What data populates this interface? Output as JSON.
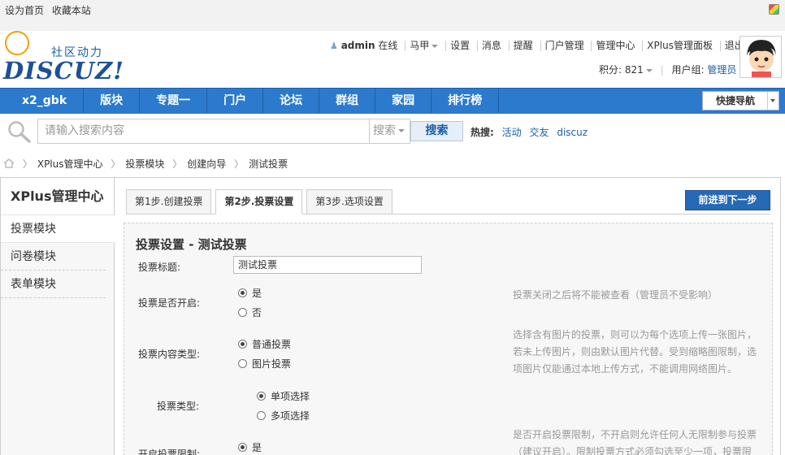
{
  "topbar": {
    "links": [
      "设为首页",
      "收藏本站"
    ]
  },
  "logo": {
    "tagline": "社区动力",
    "wordmark": "DISCUZ!"
  },
  "user_menu": {
    "username": "admin",
    "status": "在线",
    "items": [
      "马甲",
      "设置",
      "消息",
      "提醒",
      "门户管理",
      "管理中心",
      "XPlus管理面板",
      "退出"
    ],
    "credits_label": "积分: 821",
    "group_label": "用户组:",
    "group_value": "管理员"
  },
  "nav": {
    "tabs": [
      "x2_gbk",
      "版块",
      "专题一",
      "门户",
      "论坛",
      "群组",
      "家园",
      "排行榜"
    ],
    "quick_nav": "快捷导航"
  },
  "search": {
    "placeholder": "请输入搜索内容",
    "type": "搜索",
    "button": "搜索",
    "hot_label": "热搜:",
    "hot_keywords": [
      "活动",
      "交友",
      "discuz"
    ]
  },
  "breadcrumb": [
    "XPlus管理中心",
    "投票模块",
    "创建向导",
    "测试投票"
  ],
  "sidebar": {
    "title": "XPlus管理中心",
    "items": [
      "投票模块",
      "问卷模块",
      "表单模块"
    ]
  },
  "steps": [
    "第1步.创建投票",
    "第2步.投票设置",
    "第3步.选项设置"
  ],
  "next_button": "前进到下一步",
  "form": {
    "heading": "投票设置 - 测试投票",
    "title_label": "投票标题:",
    "title_value": "测试投票",
    "enabled_label": "投票是否开启:",
    "enabled_options": [
      "是",
      "否"
    ],
    "enabled_hint": "投票关闭之后将不能被查看（管理员不受影响）",
    "content_type_label": "投票内容类型:",
    "content_type_options": [
      "普通投票",
      "图片投票"
    ],
    "content_type_hint": "选择含有图片的投票，则可以为每个选项上传一张图片，若未上传图片，则由默认图片代替。受到缩略图限制，选项图片仅能通过本地上传方式，不能调用网络图片。",
    "vote_type_label": "投票类型:",
    "vote_type_options": [
      "单项选择",
      "多项选择"
    ],
    "limit_label": "开启投票限制:",
    "limit_options": [
      "是"
    ],
    "limit_hint": "是否开启投票限制，不开启则允许任何人无限制参与投票（建议开启）。限制投票方式必须勾选至少一项，投票限"
  },
  "colors": {
    "nav_bg": "#2b7acd",
    "link": "#1a5fa8",
    "next_btn": "#2669b5"
  }
}
